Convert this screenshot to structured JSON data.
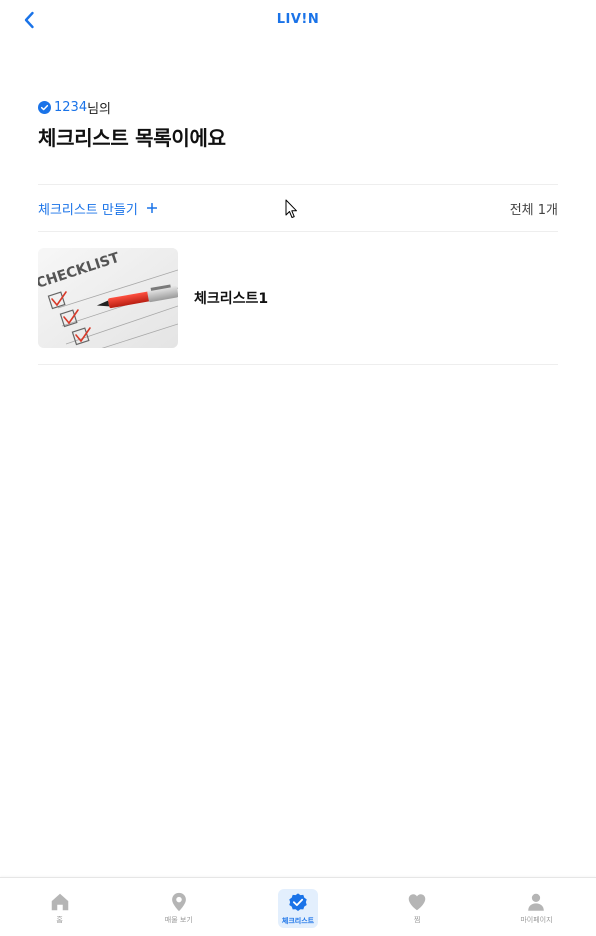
{
  "header": {
    "logo": "LIV!N",
    "back_icon": "chevron-left-icon"
  },
  "greeting": {
    "username": "1234",
    "suffix": "님의",
    "badge_icon": "verified-check-icon"
  },
  "title": "체크리스트 목록이에요",
  "toolbar": {
    "create_label": "체크리스트 만들기",
    "create_icon": "plus-icon",
    "total_label": "전체 1개"
  },
  "checklists": [
    {
      "title": "체크리스트1",
      "thumbnail": "checklist-paper-with-pen"
    }
  ],
  "bottom_nav": {
    "items": [
      {
        "label": "홈",
        "icon": "home-icon",
        "active": false
      },
      {
        "label": "매물 보기",
        "icon": "map-pin-icon",
        "active": false
      },
      {
        "label": "체크리스트",
        "icon": "check-badge-icon",
        "active": true
      },
      {
        "label": "찜",
        "icon": "heart-icon",
        "active": false
      },
      {
        "label": "마이페이지",
        "icon": "person-icon",
        "active": false
      }
    ]
  },
  "colors": {
    "accent": "#1a73e8",
    "inactive": "#b5b5b5",
    "active_bg": "#e3effd",
    "divider": "#eeeeee"
  }
}
